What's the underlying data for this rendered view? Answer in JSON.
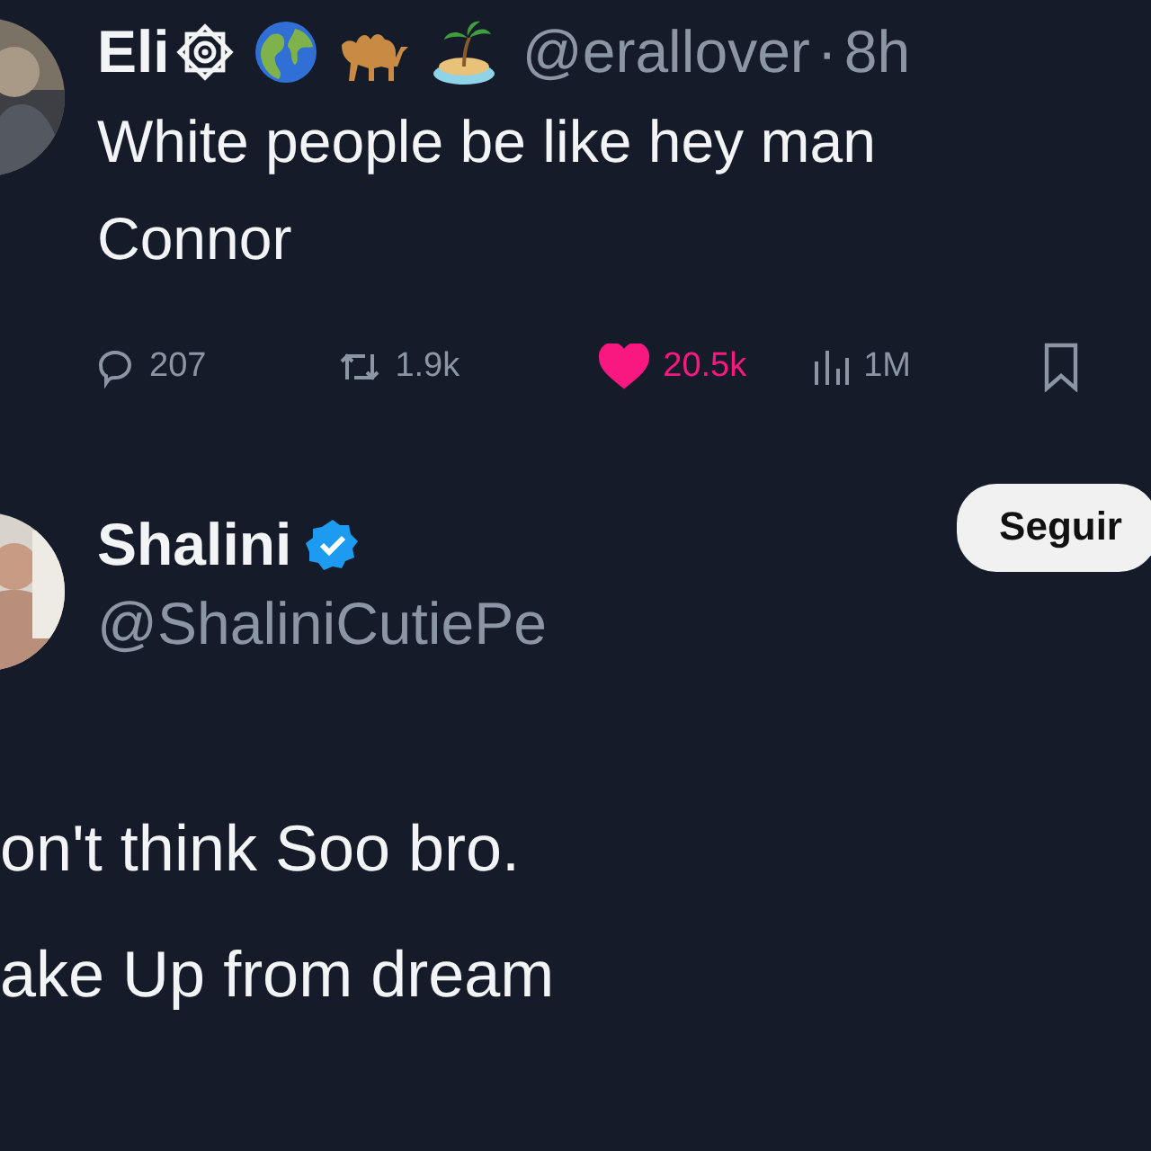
{
  "posts": [
    {
      "author": {
        "name": "Eli",
        "handle": "@erallover",
        "separator": "·",
        "time": "8h",
        "badges": [
          {
            "kind": "star-ornament"
          },
          {
            "kind": "globe"
          },
          {
            "kind": "camel"
          },
          {
            "kind": "island"
          }
        ]
      },
      "lines": [
        "White people be like hey man",
        "Connor"
      ],
      "actions": [
        {
          "kind": "reply",
          "count": "207"
        },
        {
          "kind": "repost",
          "count": "1.9k"
        },
        {
          "kind": "like",
          "count": "20.5k",
          "selected": true
        },
        {
          "kind": "views",
          "count": "1M"
        },
        {
          "kind": "bookmark"
        }
      ]
    },
    {
      "author": {
        "name": "Shalini",
        "handle": "@ShaliniCutiePe",
        "verified": true
      },
      "follow_button": "Seguir",
      "lines": [
        "on't think Soo bro.",
        "ake Up from dream"
      ]
    }
  ]
}
